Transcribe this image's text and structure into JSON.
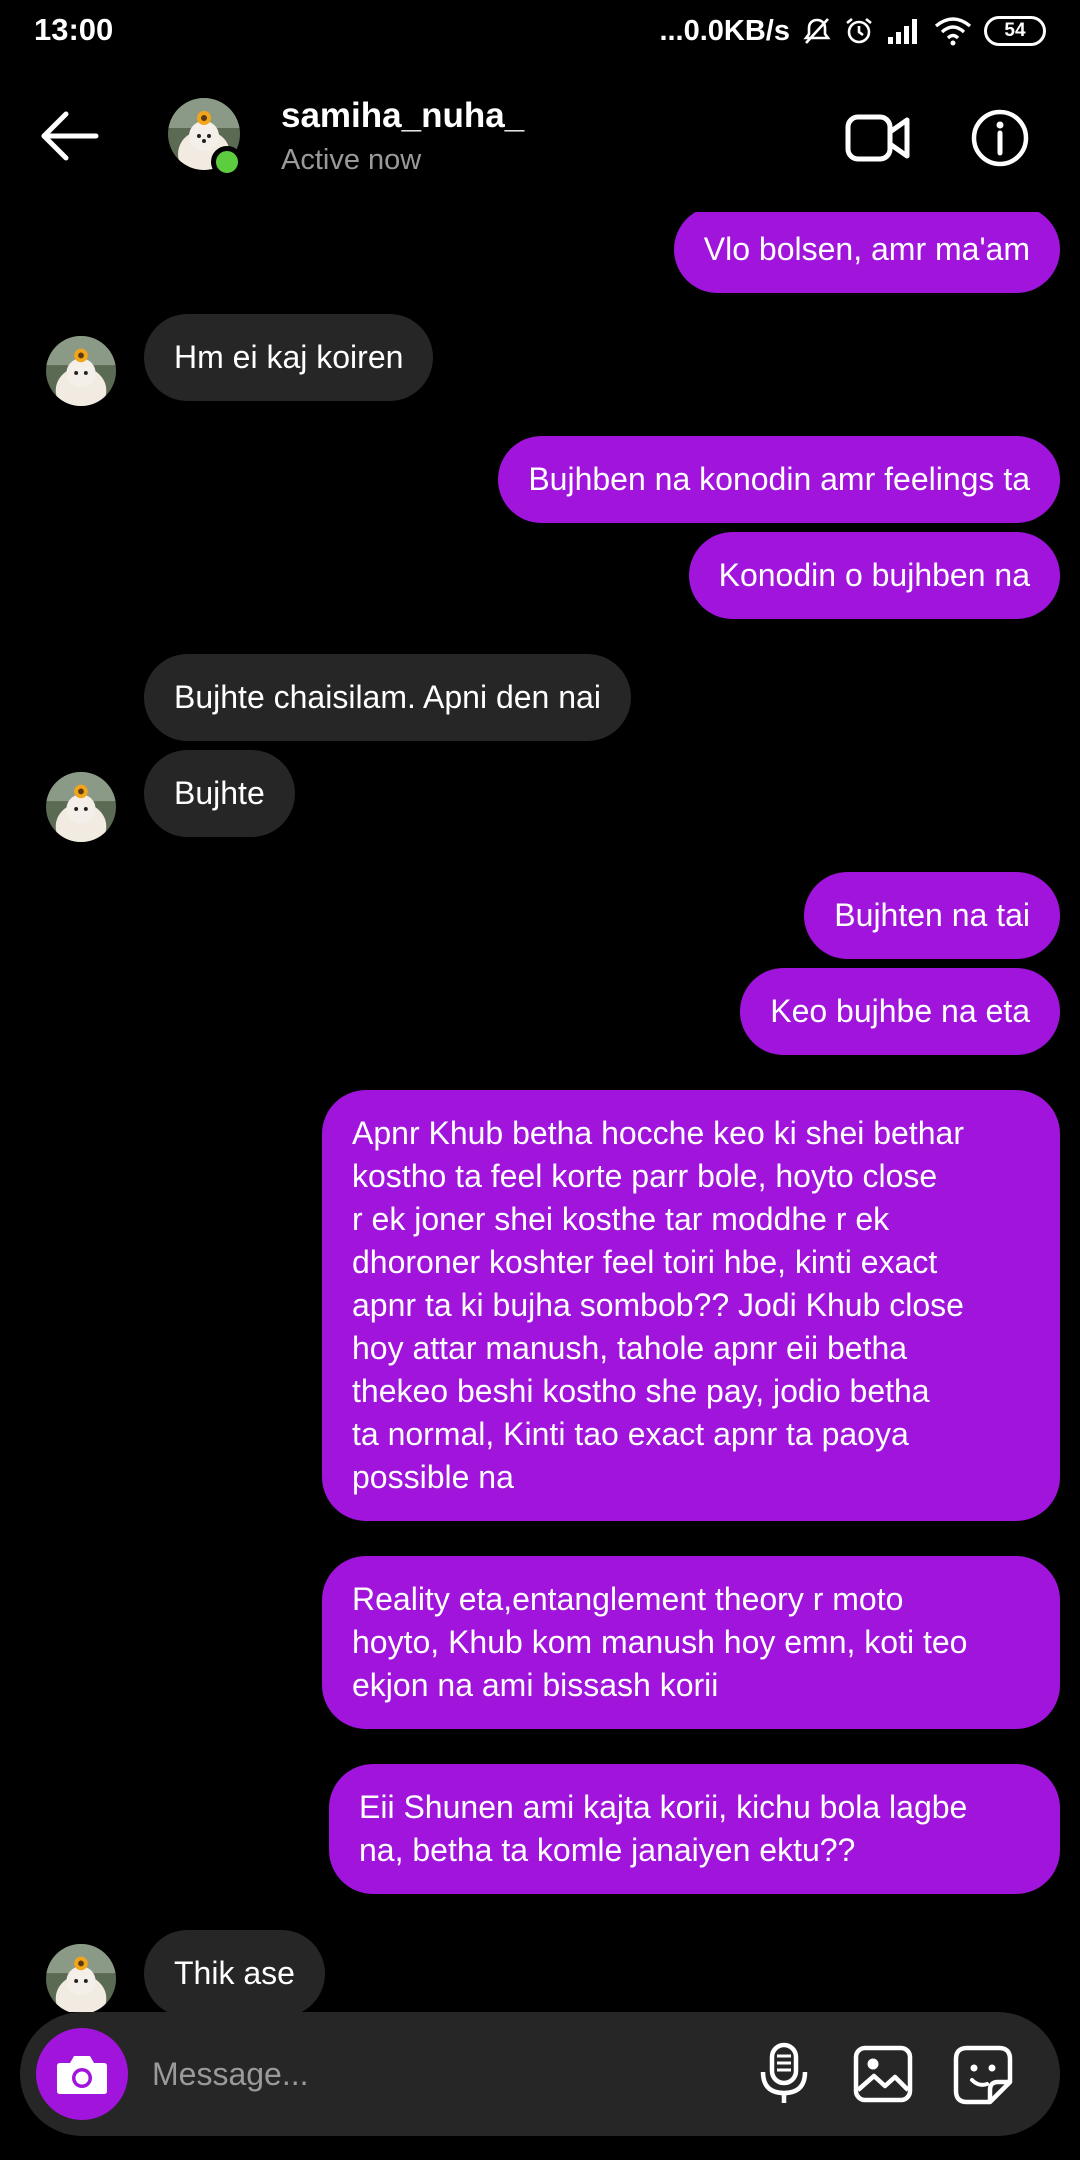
{
  "status_bar": {
    "time": "13:00",
    "network_speed": "...0.0KB/s",
    "battery": "54"
  },
  "header": {
    "contact_name": "samiha_nuha_",
    "contact_status": "Active now",
    "icons": [
      "back-arrow-icon",
      "video-call-icon",
      "info-icon"
    ]
  },
  "messages": [
    {
      "from": "me",
      "text": "Vlo bolsen, amr ma'am"
    },
    {
      "from": "them",
      "text": "Hm ei kaj koiren"
    },
    {
      "from": "me",
      "text": "Bujhben na konodin amr feelings ta"
    },
    {
      "from": "me",
      "text": "Konodin o bujhben na"
    },
    {
      "from": "them",
      "text": "Bujhte chaisilam. Apni den nai"
    },
    {
      "from": "them",
      "text": "Bujhte"
    },
    {
      "from": "me",
      "text": "Bujhten na tai"
    },
    {
      "from": "me",
      "text": "Keo bujhbe na eta"
    },
    {
      "from": "me",
      "text": "Apnr Khub betha hocche keo ki shei bethar\nkostho ta feel korte parr bole, hoyto close\nr ek joner shei kosthe tar moddhe r ek\ndhoroner koshter feel toiri hbe, kinti exact\napnr ta ki bujha sombob?? Jodi Khub close\nhoy attar manush, tahole apnr eii betha\nthekeo beshi kostho she pay, jodio betha\nta normal, Kinti tao exact apnr ta paoya\npossible na"
    },
    {
      "from": "me",
      "text": "Reality eta,entanglement theory r moto\nhoyto, Khub kom manush hoy emn, koti teo\nekjon na ami bissash korii"
    },
    {
      "from": "me",
      "text": "Eii Shunen ami kajta korii, kichu bola lagbe\nna, betha ta komle janaiyen ektu??"
    },
    {
      "from": "them",
      "text": "Thik ase"
    }
  ],
  "composer": {
    "placeholder": "Message...",
    "icons": [
      "camera-icon",
      "microphone-icon",
      "gallery-icon",
      "sticker-icon"
    ]
  },
  "colors": {
    "background": "#000000",
    "outgoing_bubble": "#a014dc",
    "incoming_bubble": "#262626",
    "online": "#5ccd3e"
  }
}
